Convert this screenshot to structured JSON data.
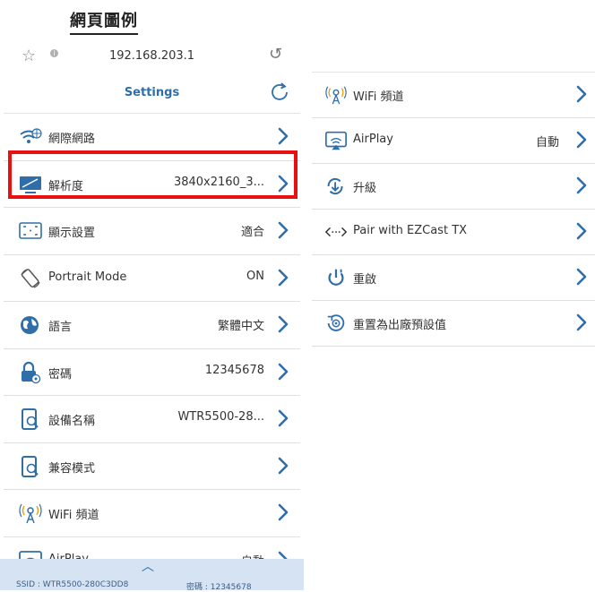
{
  "heading": "網頁圖例",
  "browser": {
    "url": "192.168.203.1"
  },
  "settings": {
    "title": "Settings",
    "items": [
      {
        "label": "網際網路",
        "value": "",
        "icon": "wifi-globe-icon"
      },
      {
        "label": "解析度",
        "value": "3840x2160_3...",
        "icon": "monitor-icon"
      },
      {
        "label": "顯示設置",
        "value": "適合",
        "icon": "screen-fit-icon"
      },
      {
        "label": "Portrait Mode",
        "value": "ON",
        "icon": "rotate-screen-icon"
      },
      {
        "label": "語言",
        "value": "繁體中文",
        "icon": "globe-icon"
      },
      {
        "label": "密碼",
        "value": "12345678",
        "icon": "lock-icon"
      },
      {
        "label": "設備名稱",
        "value": "WTR5500-28...",
        "icon": "device-edit-icon"
      },
      {
        "label": "兼容模式",
        "value": "",
        "icon": "device-edit-icon"
      },
      {
        "label": "WiFi 頻道",
        "value": "",
        "icon": "wifi-channel-icon"
      },
      {
        "label": "AirPlay",
        "value": "自動",
        "icon": "airplay-icon"
      }
    ]
  },
  "footer": {
    "ssid": "SSID : WTR5500-280C3DD8",
    "password": "密碼 : 12345678"
  },
  "right_panel": {
    "items": [
      {
        "label": "WiFi 頻道",
        "value": "",
        "icon": "wifi-channel-icon"
      },
      {
        "label": "AirPlay",
        "value": "自動",
        "icon": "airplay-icon"
      },
      {
        "label": "升級",
        "value": "",
        "icon": "upgrade-icon"
      },
      {
        "label": "Pair with EZCast TX",
        "value": "",
        "icon": "pair-icon"
      },
      {
        "label": "重啟",
        "value": "",
        "icon": "power-icon"
      },
      {
        "label": "重置為出廠預設值",
        "value": "",
        "icon": "factory-reset-icon"
      }
    ]
  },
  "colors": {
    "accent": "#2f6ea8",
    "highlight": "#e81010",
    "footer_bg": "#d5e3f2"
  }
}
